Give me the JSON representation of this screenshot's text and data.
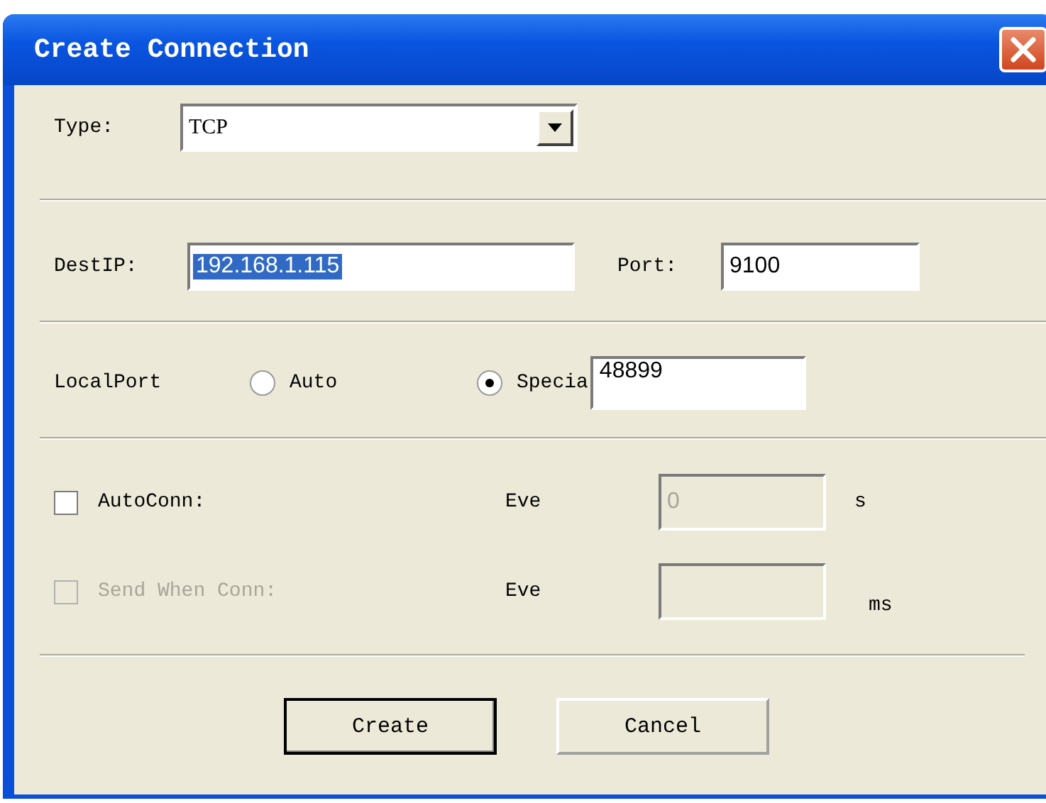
{
  "window": {
    "title": "Create Connection"
  },
  "type": {
    "label": "Type:",
    "value": "TCP"
  },
  "dest_ip": {
    "label": "DestIP:",
    "value": "192.168.1.115",
    "text_selected": true
  },
  "port": {
    "label": "Port:",
    "value": "9100"
  },
  "local_port": {
    "label": "LocalPort",
    "value": "48899",
    "options": [
      {
        "label": "Auto",
        "selected": false
      },
      {
        "label": "Specia",
        "selected": true
      }
    ]
  },
  "options": [
    {
      "label": "AutoConn:",
      "checked": false,
      "disabled": false,
      "every_label": "Eve",
      "value": "0",
      "field_disabled": true,
      "unit": "s"
    },
    {
      "label": "Send When Conn:",
      "checked": false,
      "disabled": true,
      "every_label": "Eve",
      "field_disabled": true,
      "unit": "ms"
    }
  ],
  "buttons": [
    {
      "label": "Create",
      "default": true
    },
    {
      "label": "Cancel",
      "default": false
    }
  ]
}
